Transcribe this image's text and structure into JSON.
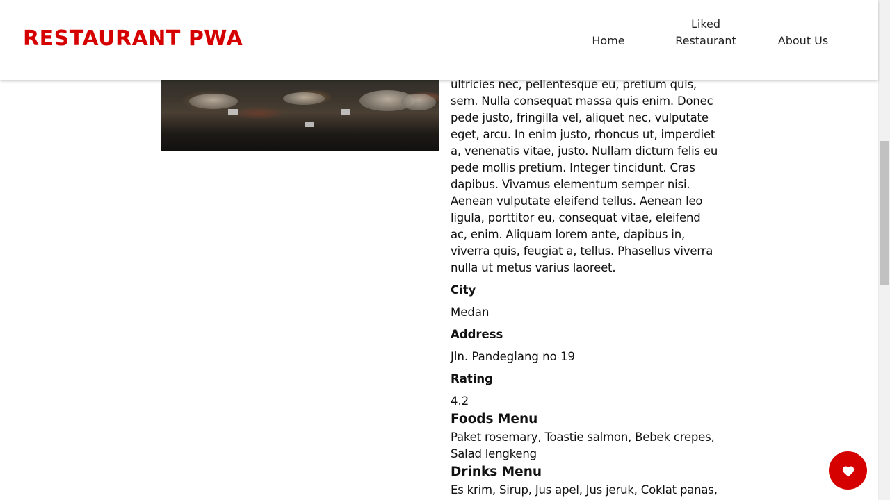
{
  "header": {
    "brand": "RESTAURANT PWA",
    "nav": {
      "home": "Home",
      "liked_line1": "Liked",
      "liked_line2": "Restaurant",
      "about": "About Us"
    }
  },
  "hero": {
    "alt": "restaurant buffet image"
  },
  "restaurant": {
    "description": "ultricies nec, pellentesque eu, pretium quis, sem. Nulla consequat massa quis enim. Donec pede justo, fringilla vel, aliquet nec, vulputate eget, arcu. In enim justo, rhoncus ut, imperdiet a, venenatis vitae, justo. Nullam dictum felis eu pede mollis pretium. Integer tincidunt. Cras dapibus. Vivamus elementum semper nisi. Aenean vulputate eleifend tellus. Aenean leo ligula, porttitor eu, consequat vitae, eleifend ac, enim. Aliquam lorem ante, dapibus in, viverra quis, feugiat a, tellus. Phasellus viverra nulla ut metus varius laoreet.",
    "city_label": "City",
    "city": "Medan",
    "address_label": "Address",
    "address": "Jln. Pandeglang no 19",
    "rating_label": "Rating",
    "rating": "4.2",
    "foods_title": "Foods Menu",
    "foods": "Paket rosemary, Toastie salmon, Bebek crepes, Salad lengkeng",
    "drinks_title": "Drinks Menu",
    "drinks": "Es krim, Sirup, Jus apel, Jus jeruk, Coklat panas,"
  },
  "like_button": {
    "icon": "heart-icon",
    "color": "#d50000"
  },
  "colors": {
    "brand": "#d50000"
  }
}
